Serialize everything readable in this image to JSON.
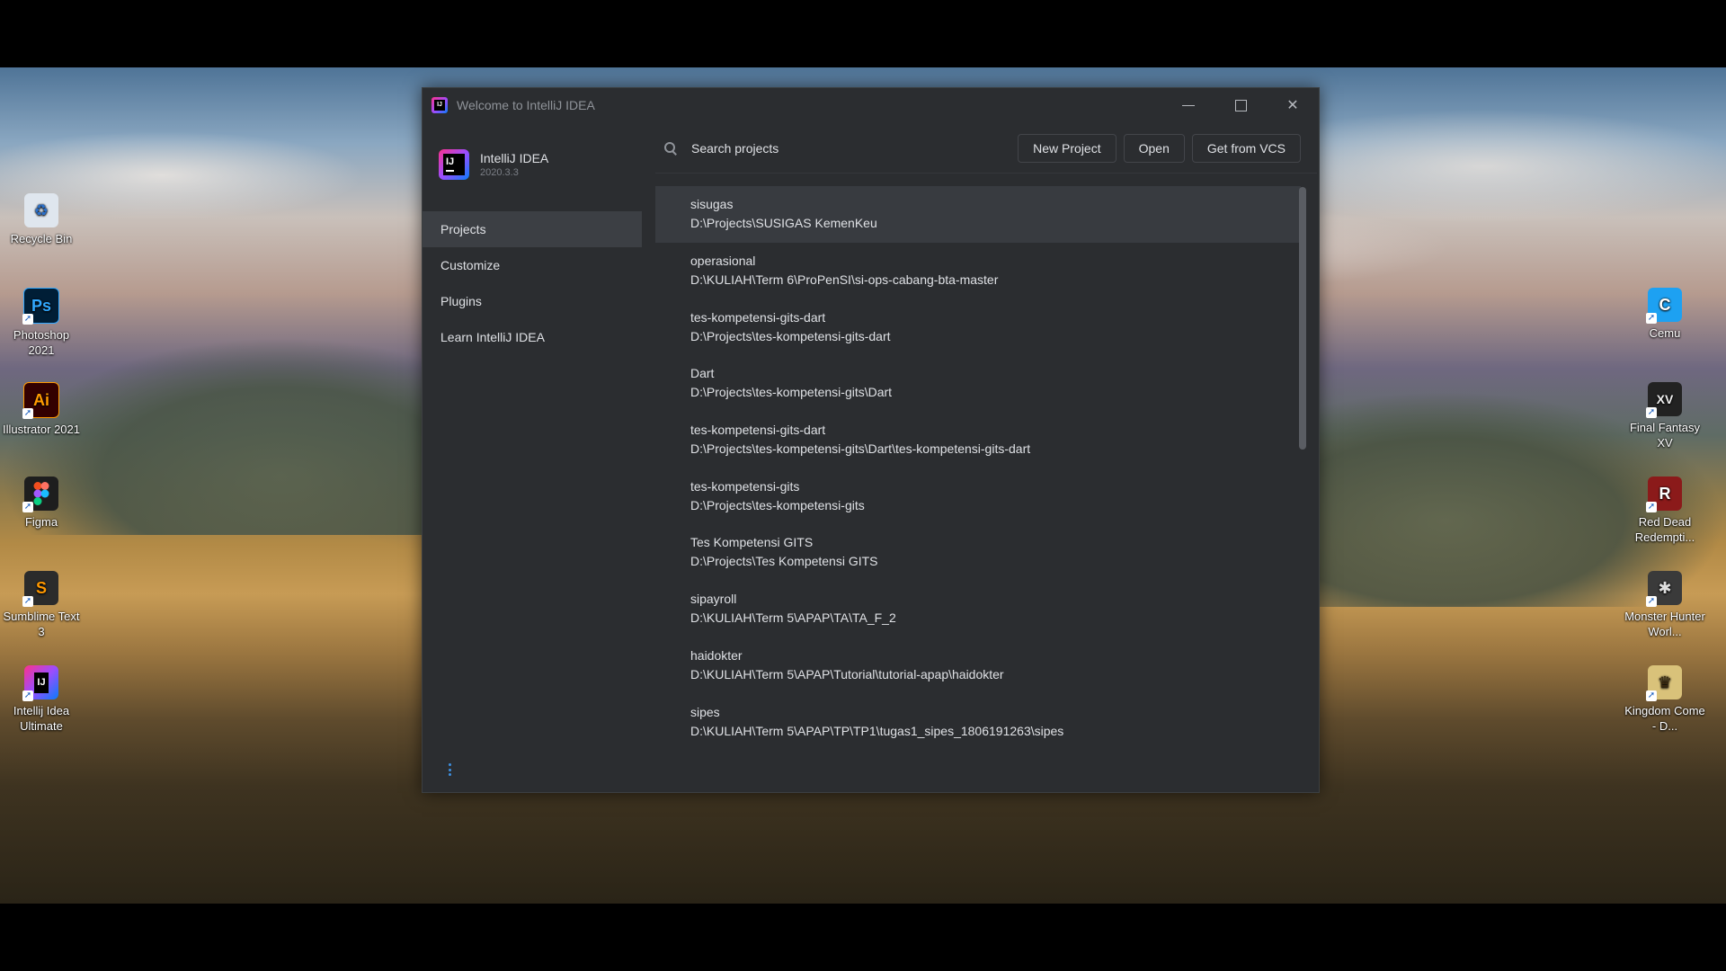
{
  "desktop": {
    "left_icons": [
      {
        "label": "Recycle Bin",
        "icon": "recycle-bin-icon",
        "color": "#dfe6ee"
      },
      {
        "label": "Photoshop 2021",
        "icon": "photoshop-icon",
        "badge": "Ps",
        "color": "#001e36",
        "text_color": "#31a8ff"
      },
      {
        "label": "Illustrator 2021",
        "icon": "illustrator-icon",
        "badge": "Ai",
        "color": "#330000",
        "text_color": "#ff9a00"
      },
      {
        "label": "Figma",
        "icon": "figma-icon",
        "color": "#1e1e1e"
      },
      {
        "label": "Sumblime Text 3",
        "icon": "sublime-text-icon",
        "color": "#2b2b2b"
      },
      {
        "label": "Intellij Idea Ultimate",
        "icon": "intellij-icon",
        "badge": "IJ",
        "color": "#000000"
      }
    ],
    "right_icons": [
      {
        "label": "Cemu",
        "icon": "cemu-icon",
        "color": "#1da1f2"
      },
      {
        "label": "Final Fantasy XV",
        "icon": "final-fantasy-icon",
        "color": "#222222"
      },
      {
        "label": "Red Dead Redempti...",
        "icon": "red-dead-icon",
        "color": "#8b1a1a"
      },
      {
        "label": "Monster Hunter Worl...",
        "icon": "monster-hunter-icon",
        "color": "#3a3a3a"
      },
      {
        "label": "Kingdom Come - D...",
        "icon": "kingdom-come-icon",
        "color": "#d9c27a"
      }
    ]
  },
  "window": {
    "title": "Welcome to IntelliJ IDEA",
    "controls": {
      "minimize": "minimize",
      "maximize": "maximize",
      "close": "✕"
    }
  },
  "product": {
    "name": "IntelliJ IDEA",
    "version": "2020.3.3",
    "logo_text": "IJ"
  },
  "nav": {
    "items": [
      {
        "label": "Projects",
        "active": true
      },
      {
        "label": "Customize",
        "active": false
      },
      {
        "label": "Plugins",
        "active": false
      },
      {
        "label": "Learn IntelliJ IDEA",
        "active": false
      }
    ]
  },
  "toolbar": {
    "search_placeholder": "Search projects",
    "new_project_label": "New Project",
    "open_label": "Open",
    "vcs_label": "Get from VCS"
  },
  "projects": [
    {
      "name": "sisugas",
      "path": "D:\\Projects\\SUSIGAS KemenKeu",
      "selected": true
    },
    {
      "name": "operasional",
      "path": "D:\\KULIAH\\Term 6\\ProPenSI\\si-ops-cabang-bta-master",
      "selected": false
    },
    {
      "name": "tes-kompetensi-gits-dart",
      "path": "D:\\Projects\\tes-kompetensi-gits-dart",
      "selected": false
    },
    {
      "name": "Dart",
      "path": "D:\\Projects\\tes-kompetensi-gits\\Dart",
      "selected": false
    },
    {
      "name": "tes-kompetensi-gits-dart",
      "path": "D:\\Projects\\tes-kompetensi-gits\\Dart\\tes-kompetensi-gits-dart",
      "selected": false
    },
    {
      "name": "tes-kompetensi-gits",
      "path": "D:\\Projects\\tes-kompetensi-gits",
      "selected": false
    },
    {
      "name": "Tes Kompetensi GITS",
      "path": "D:\\Projects\\Tes Kompetensi GITS",
      "selected": false
    },
    {
      "name": "sipayroll",
      "path": "D:\\KULIAH\\Term 5\\APAP\\TA\\TA_F_2",
      "selected": false
    },
    {
      "name": "haidokter",
      "path": "D:\\KULIAH\\Term 5\\APAP\\Tutorial\\tutorial-apap\\haidokter",
      "selected": false
    },
    {
      "name": "sipes",
      "path": "D:\\KULIAH\\Term 5\\APAP\\TP\\TP1\\tugas1_sipes_1806191263\\sipes",
      "selected": false
    }
  ],
  "theme": {
    "window_bg": "#2b2d30",
    "selected_bg": "#383b40",
    "accent": "#3d8fe0"
  }
}
